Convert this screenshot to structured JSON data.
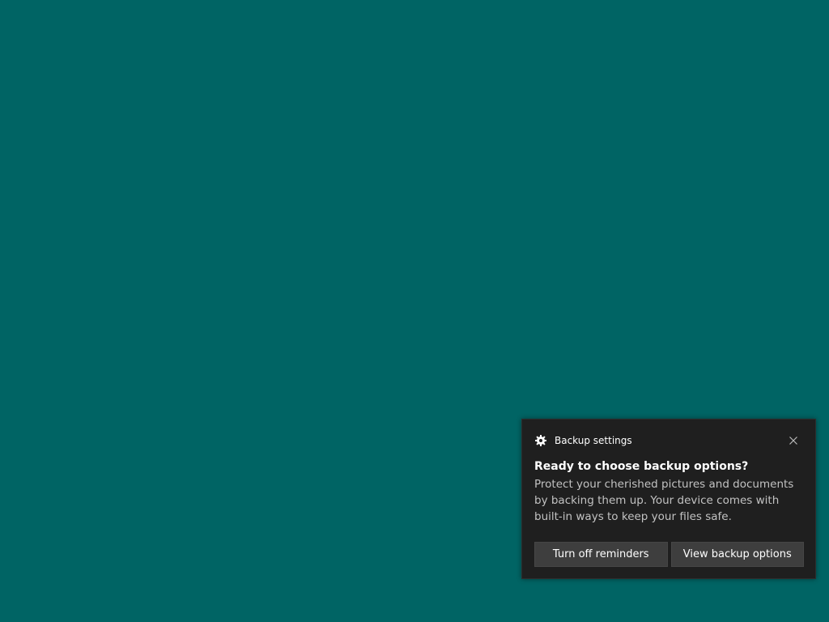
{
  "desktop": {
    "background_color": "#006464"
  },
  "toast": {
    "app_icon": "gear-icon",
    "app_name": "Backup settings",
    "close_icon": "close-icon",
    "title": "Ready to choose backup options?",
    "body": "Protect your cherished pictures and documents by backing them up. Your device comes with built-in ways to keep your files safe.",
    "actions": [
      {
        "label": "Turn off reminders"
      },
      {
        "label": "View backup options"
      }
    ],
    "colors": {
      "background": "#1f1f1f",
      "button": "#3e3e3e",
      "body_text": "#c2c2c2"
    }
  }
}
